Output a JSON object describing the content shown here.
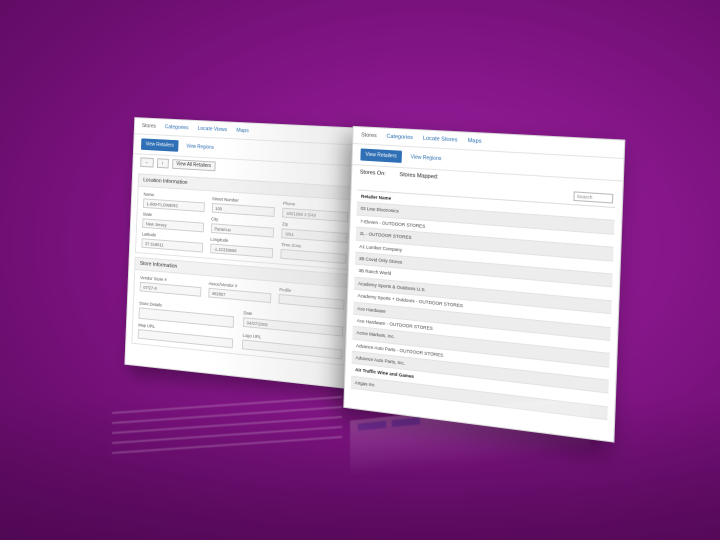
{
  "left_window": {
    "topnav": [
      "Stores",
      "Categories",
      "Locate Views",
      "Maps"
    ],
    "subtabs": [
      "View Retailers",
      "View Regions"
    ],
    "toolbar": {
      "back": "←",
      "download": "↓",
      "view_label": "View All Retailers"
    },
    "location": {
      "heading": "Location Information",
      "fields": [
        {
          "label": "Name",
          "value": "1-800-FLOWERS"
        },
        {
          "label": "Street Number",
          "value": "100"
        },
        {
          "label": "Phone",
          "value": "4/0/1998 3 5/49"
        },
        {
          "label": "State",
          "value": "New Jersey"
        },
        {
          "label": "City",
          "value": "Paramus"
        },
        {
          "label": "Zip",
          "value": "0/61"
        },
        {
          "label": "Latitude",
          "value": "37.618611"
        },
        {
          "label": "Longitude",
          "value": "-1.22339696"
        },
        {
          "label": "Time Zone",
          "value": ""
        }
      ]
    },
    "store": {
      "heading": "Store Information",
      "fields": [
        {
          "label": "Vendor Store #",
          "value": "07/27-8"
        },
        {
          "label": "Assoc/Vendor #",
          "value": "482857"
        },
        {
          "label": "Profile",
          "value": ""
        },
        {
          "label": "Store Details",
          "value": ""
        },
        {
          "label": "Date",
          "value": "04/07/2009"
        },
        {
          "label": "Map URL",
          "value": ""
        },
        {
          "label": "Logo URL",
          "value": ""
        }
      ]
    }
  },
  "right_window": {
    "topnav": [
      "Stores",
      "Categories",
      "Locate Stores",
      "Maps"
    ],
    "subtabs": [
      "View Retailers",
      "View Regions"
    ],
    "stores_on_label": "Stores On:",
    "stores_mapped_label": "Stores Mapped:",
    "search_placeholder": "Search",
    "list": [
      {
        "text": "Retailer Name",
        "strong": true
      },
      {
        "text": "03 Line Electronics",
        "strong": false
      },
      {
        "text": "7-Eleven - OUTDOOR STORES",
        "strong": false
      },
      {
        "text": "2L - OUTDOOR STORES",
        "strong": false
      },
      {
        "text": "A1 Lumber Company",
        "strong": false
      },
      {
        "text": "3B Covid Only Stores",
        "strong": false
      },
      {
        "text": "3B Ranch World",
        "strong": false
      },
      {
        "text": "Academy Sports & Outdoors U.S.",
        "strong": false
      },
      {
        "text": "Academy Sports + Outdoors - OUTDOOR STORES",
        "strong": false
      },
      {
        "text": "Ace Hardware",
        "strong": false
      },
      {
        "text": "Ace Hardware - OUTDOOR STORES",
        "strong": false
      },
      {
        "text": "Acme Markets, Inc.",
        "strong": false
      },
      {
        "text": "Advance Auto Parts - OUTDOOR STORES",
        "strong": false
      },
      {
        "text": "Advance Auto Parts, Inc.",
        "strong": false
      },
      {
        "text": "Air Traffic Wine and Games",
        "strong": true
      },
      {
        "text": "Airgas Inc",
        "strong": false
      }
    ]
  }
}
